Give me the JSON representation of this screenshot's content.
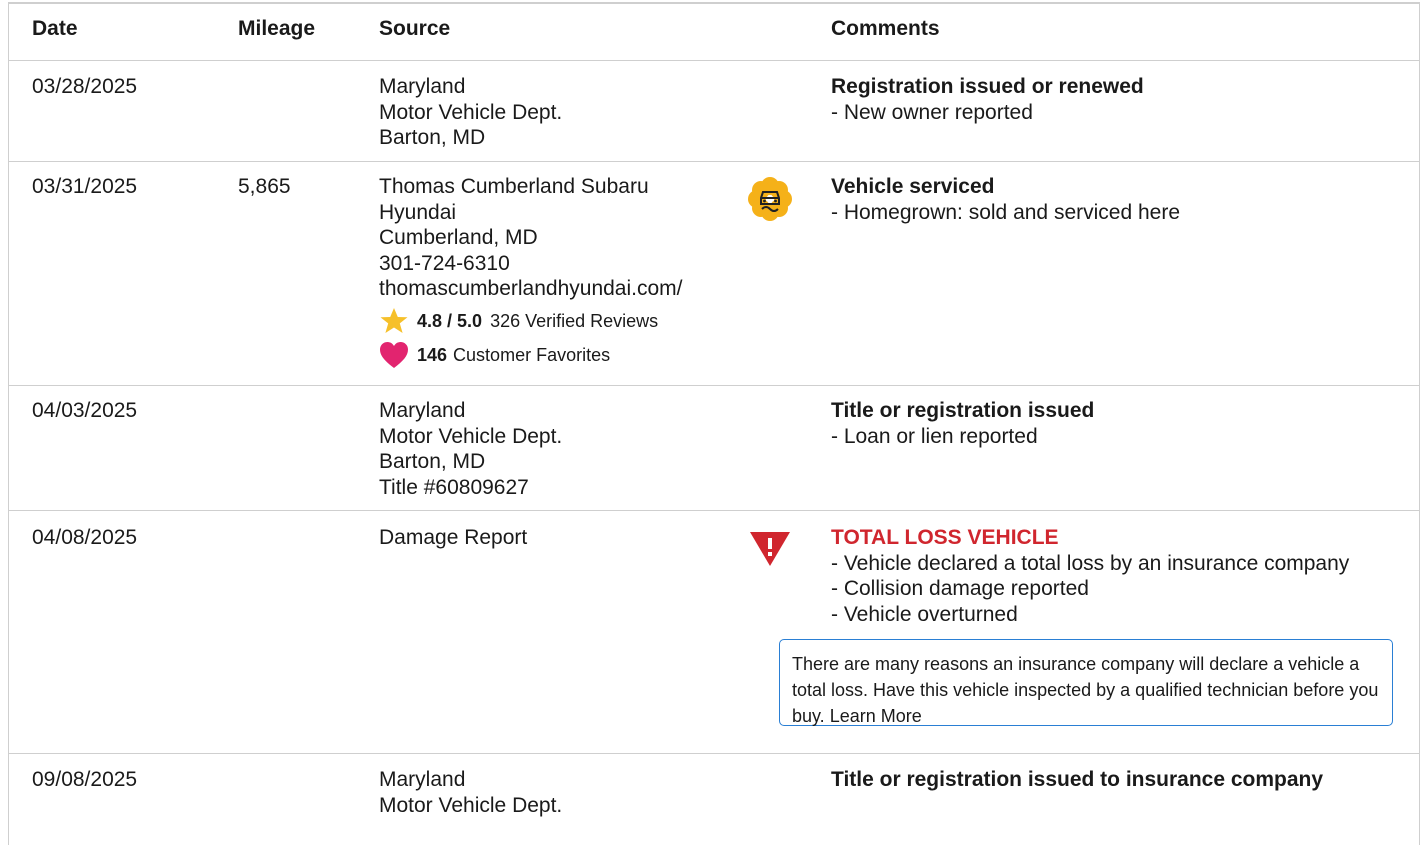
{
  "headers": {
    "date": "Date",
    "mileage": "Mileage",
    "source": "Source",
    "comments": "Comments"
  },
  "rows": [
    {
      "date": "03/28/2025",
      "mileage": "",
      "source": [
        "Maryland",
        "Motor Vehicle Dept.",
        "Barton, MD"
      ],
      "title": "Registration issued or renewed",
      "bullets": [
        "New owner reported"
      ]
    },
    {
      "date": "03/31/2025",
      "mileage": "5,865",
      "source": [
        "Thomas Cumberland Subaru",
        "Hyundai",
        "Cumberland, MD",
        "301-724-6310",
        "thomascumberlandhyundai.com/"
      ],
      "rating": {
        "score": "4.8 / 5.0",
        "reviews": "326 Verified Reviews"
      },
      "favorites": {
        "count": "146",
        "label": "Customer Favorites"
      },
      "icon": "car-service-icon",
      "title": "Vehicle serviced",
      "bullets": [
        "Homegrown: sold and serviced here"
      ]
    },
    {
      "date": "04/03/2025",
      "mileage": "",
      "source": [
        "Maryland",
        "Motor Vehicle Dept.",
        "Barton, MD",
        "Title #60809627"
      ],
      "title": "Title or registration issued",
      "bullets": [
        "Loan or lien reported"
      ]
    },
    {
      "date": "04/08/2025",
      "mileage": "",
      "source": [
        "Damage Report"
      ],
      "icon": "warning-triangle-icon",
      "title": "TOTAL LOSS VEHICLE",
      "bullets": [
        "Vehicle declared a total loss by an insurance company",
        "Collision damage reported",
        "Vehicle overturned"
      ],
      "note": {
        "text": "There are many reasons an insurance company will declare a vehicle a total loss. Have this vehicle inspected by a qualified technician before you buy.",
        "link": "Learn More"
      }
    },
    {
      "date": "09/08/2025",
      "mileage": "",
      "source": [
        "Maryland",
        "Motor Vehicle Dept."
      ],
      "title": "Title or registration issued to insurance company",
      "bullets": []
    }
  ],
  "colors": {
    "alert": "#d0262e",
    "service_badge": "#f5b119",
    "star": "#f6c02a",
    "heart": "#e2246f",
    "note_border": "#2a7fd4"
  }
}
